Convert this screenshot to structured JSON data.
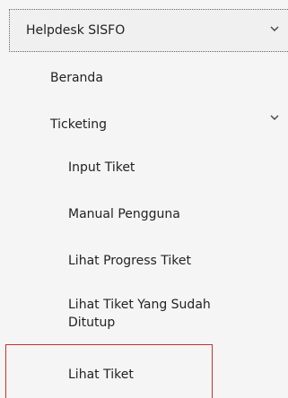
{
  "menu": {
    "root": {
      "label": "Helpdesk SISFO",
      "chevron": "chevron-down-icon"
    },
    "items": [
      {
        "label": "Beranda"
      },
      {
        "label": "Ticketing",
        "chevron": "chevron-down-icon"
      }
    ],
    "subitems": [
      {
        "label": "Input Tiket"
      },
      {
        "label": "Manual Pengguna"
      },
      {
        "label": "Lihat Progress Tiket"
      },
      {
        "label": "Lihat Tiket Yang Sudah Ditutup"
      },
      {
        "label": "Lihat Tiket"
      }
    ]
  },
  "colors": {
    "background": "#f5f5f5",
    "text": "#222222",
    "active_border": "#c9302c"
  }
}
